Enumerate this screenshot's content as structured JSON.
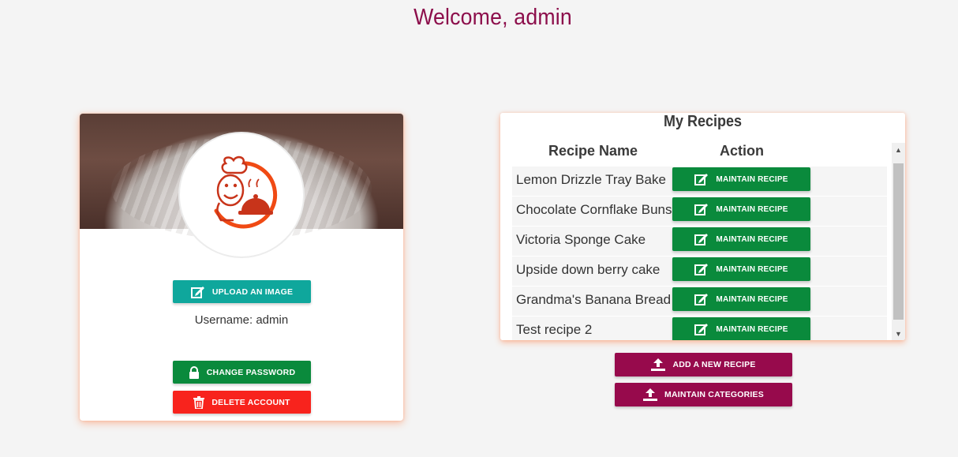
{
  "welcome": "Welcome, admin",
  "profile": {
    "upload_label": "UPLOAD AN IMAGE",
    "username_text": "Username: admin",
    "change_password_label": "CHANGE PASSWORD",
    "delete_account_label": "DELETE ACCOUNT"
  },
  "recipes": {
    "title": "My Recipes",
    "col_name": "Recipe Name",
    "col_action": "Action",
    "items": [
      {
        "name": "Lemon Drizzle Tray Bake",
        "action": "MAINTAIN RECIPE"
      },
      {
        "name": "Chocolate Cornflake Buns",
        "action": "MAINTAIN RECIPE"
      },
      {
        "name": "Victoria Sponge Cake",
        "action": "MAINTAIN RECIPE"
      },
      {
        "name": "Upside down berry cake",
        "action": "MAINTAIN RECIPE"
      },
      {
        "name": "Grandma's Banana Bread",
        "action": "MAINTAIN RECIPE"
      },
      {
        "name": "Test recipe 2",
        "action": "MAINTAIN RECIPE"
      }
    ],
    "add_label": "ADD A NEW RECIPE",
    "categories_label": "MAINTAIN CATEGORIES"
  },
  "colors": {
    "accent": "#8c0e4b",
    "teal": "#0fa79c",
    "green": "#0a8a3c",
    "red": "#f8231d",
    "purple": "#970a4c"
  },
  "icons": {
    "upload": "edit-icon",
    "maintain": "edit-icon",
    "password": "lock-icon",
    "delete": "trash-icon",
    "add": "upload-icon",
    "categories": "upload-icon"
  }
}
